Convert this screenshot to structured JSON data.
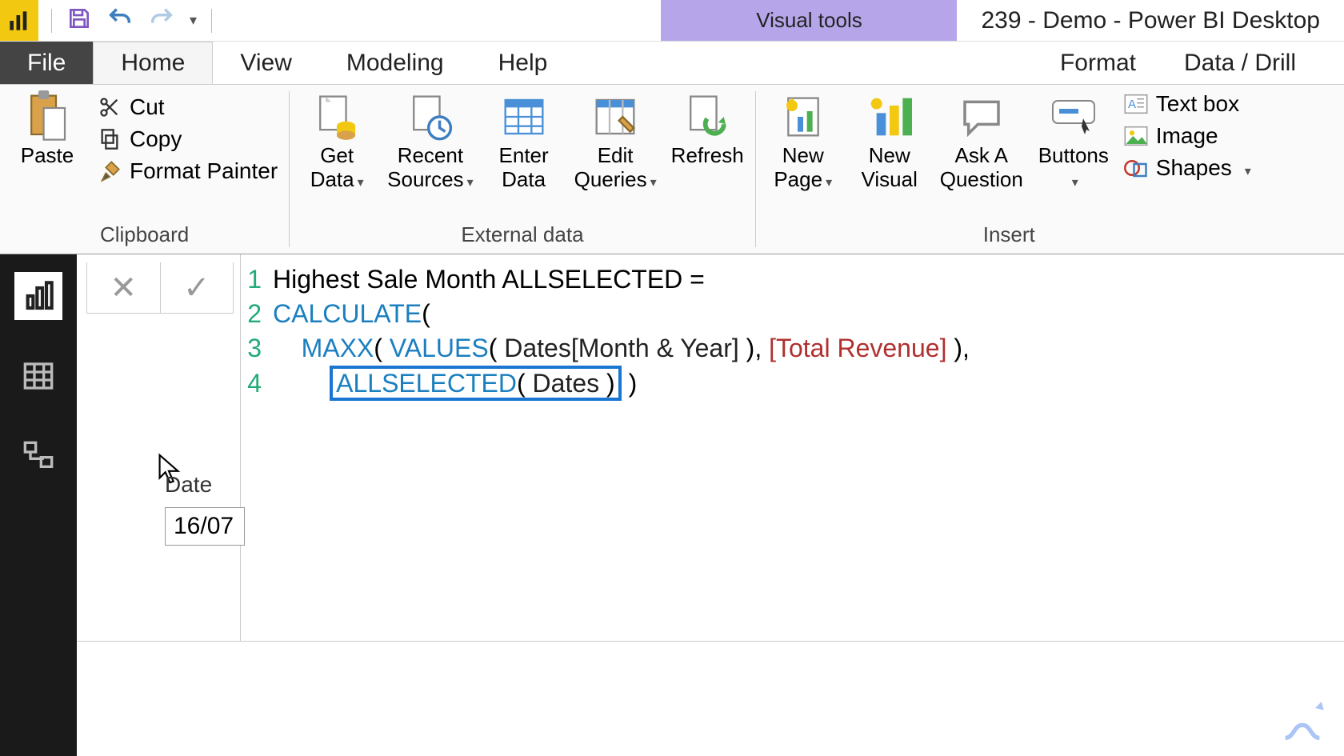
{
  "titlebar": {
    "visual_tools": "Visual tools",
    "document": "239 - Demo - Power BI Desktop"
  },
  "tabs": {
    "file": "File",
    "home": "Home",
    "view": "View",
    "modeling": "Modeling",
    "help": "Help",
    "format": "Format",
    "datadrill": "Data / Drill"
  },
  "ribbon": {
    "clipboard": {
      "paste": "Paste",
      "cut": "Cut",
      "copy": "Copy",
      "format_painter": "Format Painter",
      "group": "Clipboard"
    },
    "external": {
      "get_data": "Get\nData",
      "recent_sources": "Recent\nSources",
      "enter_data": "Enter\nData",
      "edit_queries": "Edit\nQueries",
      "refresh": "Refresh",
      "group": "External data"
    },
    "insert": {
      "new_page": "New\nPage",
      "new_visual": "New\nVisual",
      "ask": "Ask A\nQuestion",
      "buttons": "Buttons",
      "textbox": "Text box",
      "image": "Image",
      "shapes": "Shapes",
      "group": "Insert"
    }
  },
  "formula": {
    "l1": "Highest Sale Month ALLSELECTED =",
    "l2_calc": "CALCULATE",
    "l3_maxx": "MAXX",
    "l3_values": "VALUES",
    "l3_col": "Dates[Month & Year]",
    "l3_measure": "[Total Revenue]",
    "l4_allsel": "ALLSELECTED",
    "l4_tbl": "Dates"
  },
  "slicer": {
    "title": "Date",
    "value": "16/07"
  }
}
